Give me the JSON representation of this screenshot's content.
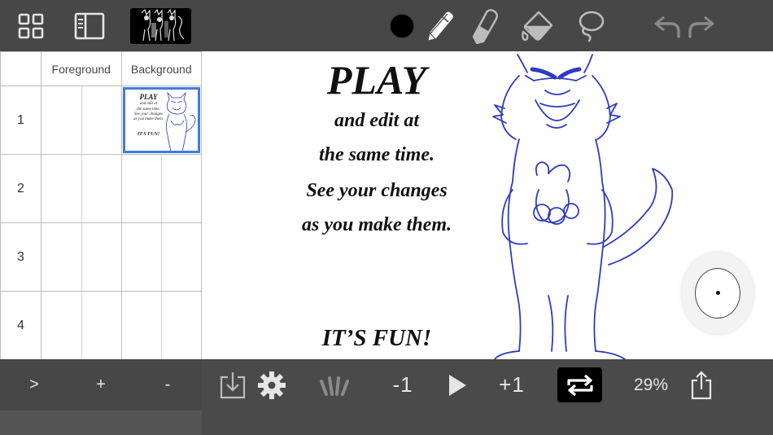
{
  "timeline": {
    "columns": [
      "Foreground",
      "Background"
    ],
    "rows": [
      "1",
      "2",
      "3",
      "4"
    ],
    "controls": {
      "next": ">",
      "add": "+",
      "remove": "-"
    },
    "thumbnail_lines": [
      "PLAY",
      "and edit at",
      "the same time.",
      "See your changes",
      "as you make them.",
      "IT'S FUN!"
    ]
  },
  "canvas": {
    "lines": {
      "title": "PLAY",
      "line1": "and edit at",
      "line2": "the same time.",
      "line3": "See your changes",
      "line4": "as you make them.",
      "footer": "IT’S FUN!"
    }
  },
  "bottom_bar": {
    "step_back": "-1",
    "step_forward": "+1",
    "zoom": "29%"
  },
  "toolbar": {
    "icons": [
      "grid-icon",
      "layers-panel-icon",
      "brush-color-swatch",
      "pencil-icon",
      "eraser-icon",
      "fill-bucket-icon",
      "lasso-icon",
      "undo-icon",
      "redo-icon"
    ]
  },
  "colors": {
    "toolbar_bg": "#474747",
    "selection": "#3d7ce6",
    "sketch_blue": "#2d3bc4",
    "icon": "#e6e6e6",
    "icon_disabled": "#8a8a8a"
  }
}
